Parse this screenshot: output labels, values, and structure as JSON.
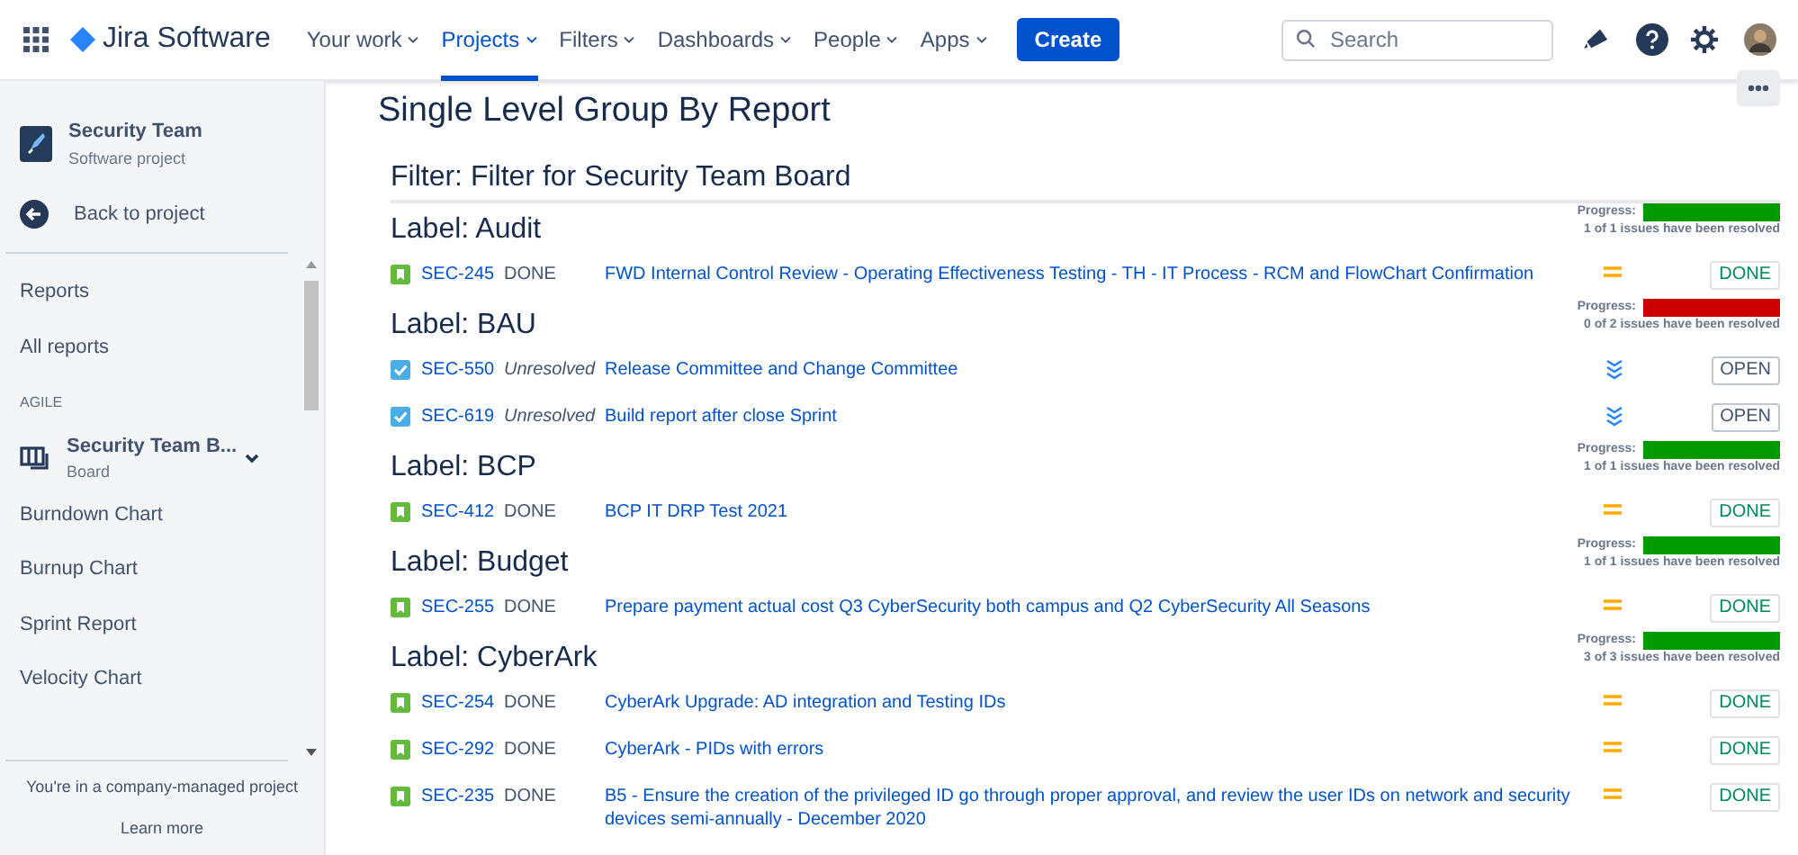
{
  "header": {
    "product": "Jira Software",
    "nav": [
      {
        "label": "Your work",
        "selected": false
      },
      {
        "label": "Projects",
        "selected": true
      },
      {
        "label": "Filters",
        "selected": false
      },
      {
        "label": "Dashboards",
        "selected": false
      },
      {
        "label": "People",
        "selected": false
      },
      {
        "label": "Apps",
        "selected": false
      }
    ],
    "create_button": "Create",
    "search": {
      "placeholder": "Search"
    }
  },
  "sidebar": {
    "project_name": "Security Team",
    "project_type": "Software project",
    "back": "Back to project",
    "section": "Reports",
    "all_reports": "All reports",
    "group": "AGILE",
    "board": {
      "name": "Security Team B...",
      "type": "Board"
    },
    "items": [
      "Burndown Chart",
      "Burnup Chart",
      "Sprint Report",
      "Velocity Chart"
    ],
    "footer": "You're in a company-managed project",
    "learn_more": "Learn more"
  },
  "report": {
    "title": "Single Level Group By Report",
    "filter": "Filter: Filter for Security Team Board",
    "groups": [
      {
        "label": "Label: Audit",
        "progress_label": "Progress:",
        "level": 1,
        "resolved_text": "1 of 1 issues have been resolved",
        "issues": [
          {
            "type": {
              "kind": "story"
            },
            "key": "SEC-245",
            "resolution": "DONE",
            "resolved": true,
            "summary": "FWD Internal Control Review - Operating Effectiveness Testing - TH - IT Process - RCM and FlowChart Confirmation",
            "priority": {
              "kind": "medium"
            },
            "status": "DONE"
          }
        ]
      },
      {
        "label": "Label: BAU",
        "progress_label": "Progress:",
        "level": 0,
        "resolved_text": "0 of 2 issues have been resolved",
        "issues": [
          {
            "type": {
              "kind": "task"
            },
            "key": "SEC-550",
            "resolution": "Unresolved",
            "resolved": false,
            "summary": "Release Committee and Change Committee",
            "priority": {
              "kind": "lowest"
            },
            "status": "OPEN"
          },
          {
            "type": {
              "kind": "task"
            },
            "key": "SEC-619",
            "resolution": "Unresolved",
            "resolved": false,
            "summary": "Build report after close Sprint",
            "priority": {
              "kind": "lowest"
            },
            "status": "OPEN"
          }
        ]
      },
      {
        "label": "Label: BCP",
        "progress_label": "Progress:",
        "level": 1,
        "resolved_text": "1 of 1 issues have been resolved",
        "issues": [
          {
            "type": {
              "kind": "story"
            },
            "key": "SEC-412",
            "resolution": "DONE",
            "resolved": true,
            "summary": "BCP IT DRP Test 2021",
            "priority": {
              "kind": "medium"
            },
            "status": "DONE"
          }
        ]
      },
      {
        "label": "Label: Budget",
        "progress_label": "Progress:",
        "level": 1,
        "resolved_text": "1 of 1 issues have been resolved",
        "issues": [
          {
            "type": {
              "kind": "story"
            },
            "key": "SEC-255",
            "resolution": "DONE",
            "resolved": true,
            "summary": "Prepare payment actual cost Q3 CyberSecurity both campus and Q2 CyberSecurity All Seasons",
            "priority": {
              "kind": "medium"
            },
            "status": "DONE"
          }
        ]
      },
      {
        "label": "Label: CyberArk",
        "progress_label": "Progress:",
        "level": 1,
        "resolved_text": "3 of 3 issues have been resolved",
        "issues": [
          {
            "type": {
              "kind": "story"
            },
            "key": "SEC-254",
            "resolution": "DONE",
            "resolved": true,
            "summary": "CyberArk Upgrade: AD integration and Testing IDs",
            "priority": {
              "kind": "medium"
            },
            "status": "DONE"
          },
          {
            "type": {
              "kind": "story"
            },
            "key": "SEC-292",
            "resolution": "DONE",
            "resolved": true,
            "summary": "CyberArk - PIDs with errors",
            "priority": {
              "kind": "medium"
            },
            "status": "DONE"
          },
          {
            "type": {
              "kind": "story"
            },
            "key": "SEC-235",
            "resolution": "DONE",
            "resolved": true,
            "summary": "B5 - Ensure the creation of the privileged ID go through proper approval, and review the user IDs on network and security devices semi-annually - December 2020",
            "priority": {
              "kind": "medium"
            },
            "status": "DONE"
          }
        ]
      }
    ]
  }
}
